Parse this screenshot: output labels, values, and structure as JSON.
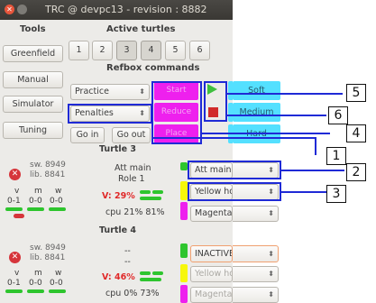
{
  "window": {
    "title": "TRC @ devpc13 - revision : 8882"
  },
  "tools": {
    "header": "Tools",
    "items": [
      {
        "label": "Greenfield"
      },
      {
        "label": "Manual"
      },
      {
        "label": "Simulator"
      },
      {
        "label": "Tuning"
      }
    ]
  },
  "active_turtles": {
    "header": "Active turtles",
    "buttons": [
      "1",
      "2",
      "3",
      "4",
      "5",
      "6"
    ]
  },
  "refbox": {
    "header": "Refbox commands",
    "practice": "Practice",
    "penalties": "Penalties",
    "go_in": "Go in",
    "go_out": "Go out",
    "cmd_top": "Start",
    "cmd_mid": "Reduce",
    "cmd_bot": "Place",
    "play_icon": "play-icon",
    "stop_icon": "stop-icon",
    "soft": "Soft",
    "medium": "Medium",
    "hard": "Hard"
  },
  "turtles": [
    {
      "title": "Turtle 3",
      "sw": "sw. 8949",
      "lib": "lib. 8841",
      "col_v": "v",
      "col_m": "m",
      "col_w": "w",
      "val_v": "0-1",
      "val_m": "0-0",
      "val_w": "0-0",
      "role_main": "Att main",
      "role_sub": "Role 1",
      "voltage": "V: 29%",
      "cpu": "cpu  21% 81%",
      "role_select": "Att main",
      "home_select": "Yellow home",
      "color_select": "Magenta"
    },
    {
      "title": "Turtle 4",
      "sw": "sw. 8949",
      "lib": "lib. 8841",
      "col_v": "v",
      "col_m": "m",
      "col_w": "w",
      "val_v": "0-1",
      "val_m": "0-0",
      "val_w": "0-0",
      "role_main": "--",
      "role_sub": "--",
      "voltage": "V: 46%",
      "cpu": "cpu   0% 73%",
      "role_select": "INACTIVE",
      "home_select": "Yellow home",
      "color_select": "Magenta"
    }
  ],
  "callouts": [
    "1",
    "2",
    "3",
    "4",
    "5",
    "6"
  ],
  "colors": {
    "magenta": "#ee20ee",
    "cyan": "#54e0ff",
    "green": "#2ec52e",
    "red": "#d6353b",
    "yellow": "#f7f70a",
    "annotation_blue": "#1f2ad6"
  }
}
